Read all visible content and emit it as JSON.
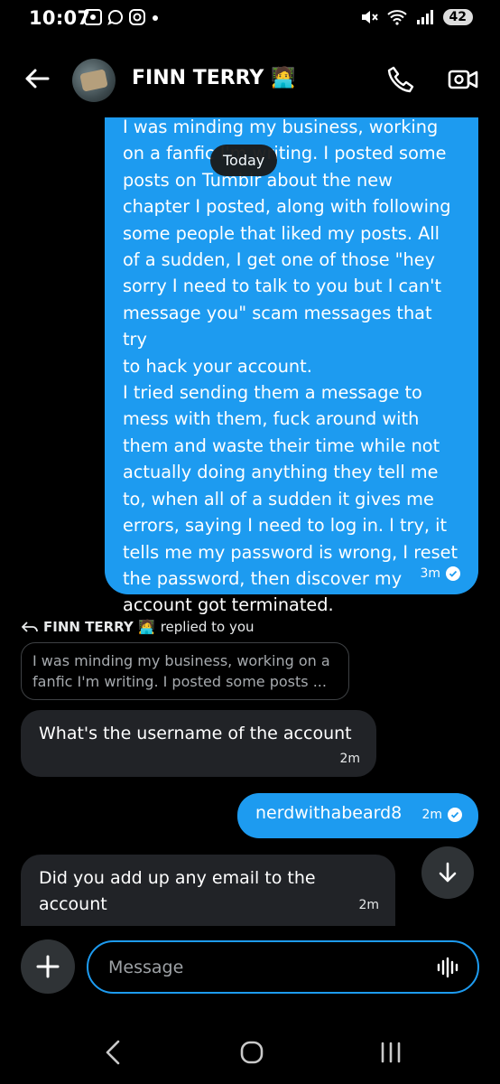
{
  "status_bar": {
    "time": "10:07",
    "battery": "42"
  },
  "header": {
    "contact_name": "FINN TERRY 🧑‍💻"
  },
  "chat": {
    "date_pill": "Today",
    "messages": [
      {
        "direction": "outgoing",
        "lines": [
          "I was minding my business, working",
          "on a fanfic I'm writing. I posted some",
          "posts on Tumblr about the new",
          "chapter I posted, along with following",
          "some people that liked my posts. All",
          "of a sudden, I get one of those \"hey",
          "sorry I need to talk to you but I can't",
          "message you\" scam messages that try",
          "to hack your account.",
          "I tried sending them a message to",
          "mess with them, fuck around with",
          "them and waste their time while not",
          "actually doing anything they tell me",
          "to, when all of a sudden it gives me",
          "errors, saying I need to log in. I try, it",
          "tells me my password is wrong, I reset",
          "the password, then discover my",
          "account got terminated."
        ],
        "time": "3m"
      },
      {
        "direction": "incoming",
        "reply_author": "FINN TERRY 🧑‍💻",
        "reply_suffix": "replied to you",
        "quoted_line1": "I was minding my business, working on a",
        "quoted_line2": "fanfic I'm writing. I posted some posts ...",
        "text": "What's the username of the account",
        "time": "2m"
      },
      {
        "direction": "outgoing",
        "text": "nerdwithabeard8",
        "time": "2m"
      },
      {
        "direction": "incoming",
        "text_line1": "Did you add up any email to the",
        "text_line2": "account",
        "time": "2m"
      }
    ]
  },
  "composer": {
    "placeholder": "Message"
  },
  "colors": {
    "accent": "#1d9bf0",
    "incoming_bubble": "#212327",
    "background": "#000000"
  }
}
